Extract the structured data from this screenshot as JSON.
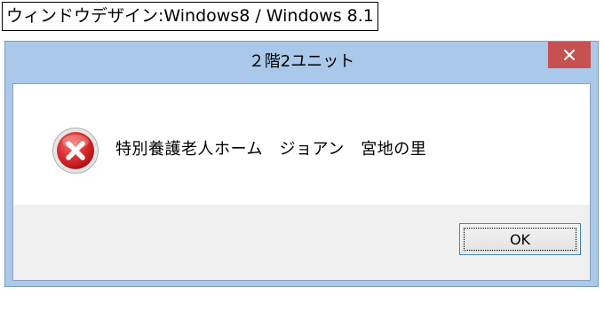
{
  "caption": "ウィンドウデザイン:Windows8 / Windows 8.1",
  "dialog": {
    "title": "２階2ユニット",
    "close_icon": "close-icon",
    "message_icon": "error-icon",
    "message": "特別養護老人ホーム　ジョアン　宮地の里",
    "ok_label": "OK"
  },
  "colors": {
    "frame": "#aac8e9",
    "close_button": "#c75050",
    "button_area": "#f0f0f0",
    "error_red": "#d9282b"
  }
}
